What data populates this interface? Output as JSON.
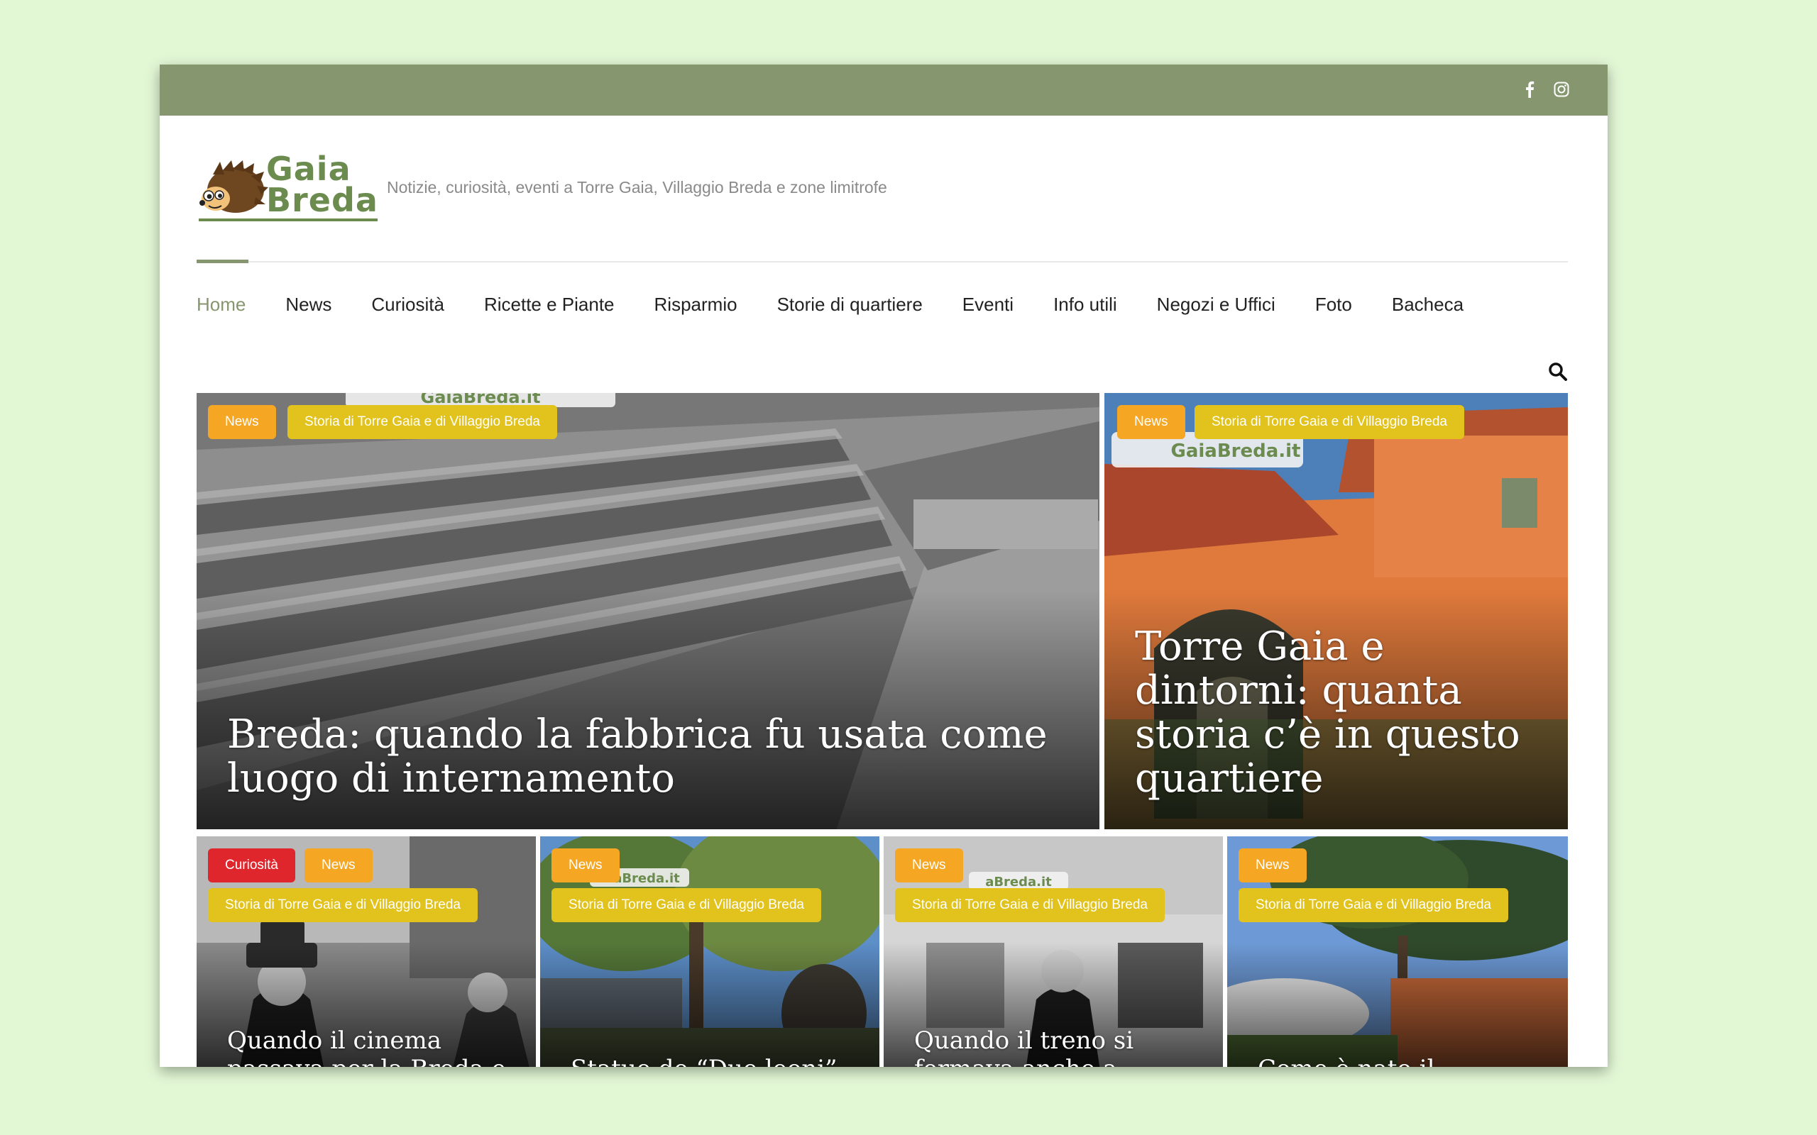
{
  "site": {
    "logo_line1": "Gaia",
    "logo_line2": "Breda",
    "tagline": "Notizie, curiosità, eventi a Torre Gaia, Villaggio Breda e zone limitrofe"
  },
  "topbar": {
    "social": [
      "facebook-icon",
      "instagram-icon"
    ]
  },
  "nav": {
    "items": [
      {
        "label": "Home"
      },
      {
        "label": "News"
      },
      {
        "label": "Curiosità"
      },
      {
        "label": "Ricette e Piante"
      },
      {
        "label": "Risparmio"
      },
      {
        "label": "Storie di quartiere"
      },
      {
        "label": "Eventi"
      },
      {
        "label": "Info utili"
      },
      {
        "label": "Negozi e Uffici"
      },
      {
        "label": "Foto"
      },
      {
        "label": "Bacheca"
      }
    ],
    "active": "Home"
  },
  "featured": [
    {
      "title": "Breda: quando la fabbrica fu usata come luogo di internamento",
      "tags": [
        "News",
        "Storia di Torre Gaia e di Villaggio Breda"
      ]
    },
    {
      "title": "Torre Gaia e dintorni: quanta storia c’è in questo quartiere",
      "tags": [
        "News",
        "Storia di Torre Gaia e di Villaggio Breda"
      ]
    }
  ],
  "posts": [
    {
      "title": "Quando il cinema passava per la Breda e",
      "tags": [
        "Curiosità",
        "News",
        "Storia di Torre Gaia e di Villaggio Breda"
      ]
    },
    {
      "title": "Statue de “Due leoni”, la",
      "tags": [
        "News",
        "Storia di Torre Gaia e di Villaggio Breda"
      ]
    },
    {
      "title": "Quando il treno si fermava anche a Torre",
      "tags": [
        "News",
        "Storia di Torre Gaia e di Villaggio Breda"
      ]
    },
    {
      "title": "Come è nato il Villaggio",
      "tags": [
        "News",
        "Storia di Torre Gaia e di Villaggio Breda"
      ]
    }
  ],
  "watermark": "GaiaBreda.it",
  "colors": {
    "page_bg": "#e2f8d5",
    "topbar": "#86966f",
    "brand_green": "#6b8b4f",
    "tag_news": "#f5a623",
    "tag_storia": "#e2c21c",
    "tag_curiosita": "#e0262d"
  }
}
